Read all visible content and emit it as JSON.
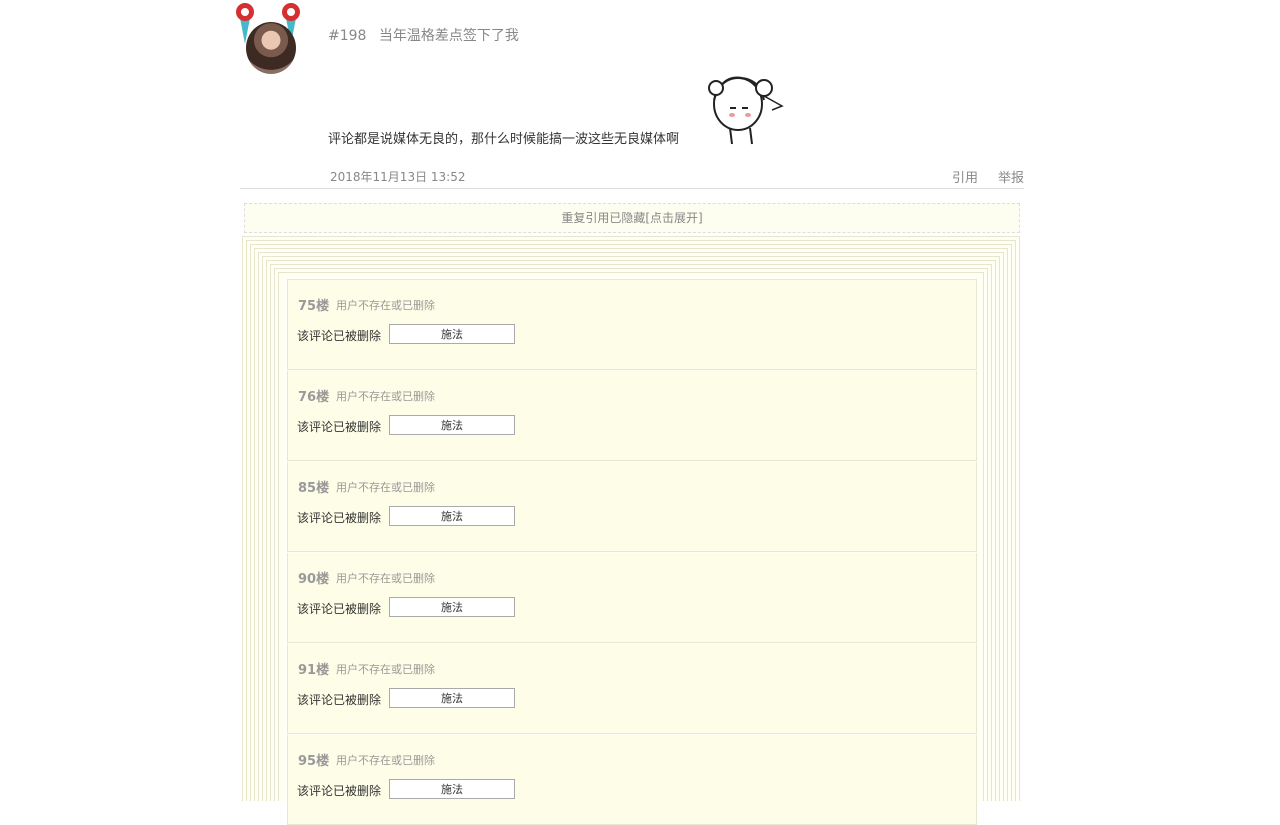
{
  "post": {
    "number": "#198",
    "username": "当年温格差点签下了我",
    "content": "评论都是说媒体无良的，那什么时候能搞一波这些无良媒体啊",
    "timestamp": "2018年11月13日  13:52",
    "quote_label": "引用",
    "report_label": "举报"
  },
  "hidden_quotes_label": "重复引用已隐藏[点击展开]",
  "replies": [
    {
      "floor": "75楼",
      "user": "用户不存在或已删除",
      "text": "该评论已被删除",
      "button": "施法"
    },
    {
      "floor": "76楼",
      "user": "用户不存在或已删除",
      "text": "该评论已被删除",
      "button": "施法"
    },
    {
      "floor": "85楼",
      "user": "用户不存在或已删除",
      "text": "该评论已被删除",
      "button": "施法"
    },
    {
      "floor": "90楼",
      "user": "用户不存在或已删除",
      "text": "该评论已被删除",
      "button": "施法"
    },
    {
      "floor": "91楼",
      "user": "用户不存在或已删除",
      "text": "该评论已被删除",
      "button": "施法"
    },
    {
      "floor": "95楼",
      "user": "用户不存在或已删除",
      "text": "该评论已被删除",
      "button": "施法"
    }
  ]
}
